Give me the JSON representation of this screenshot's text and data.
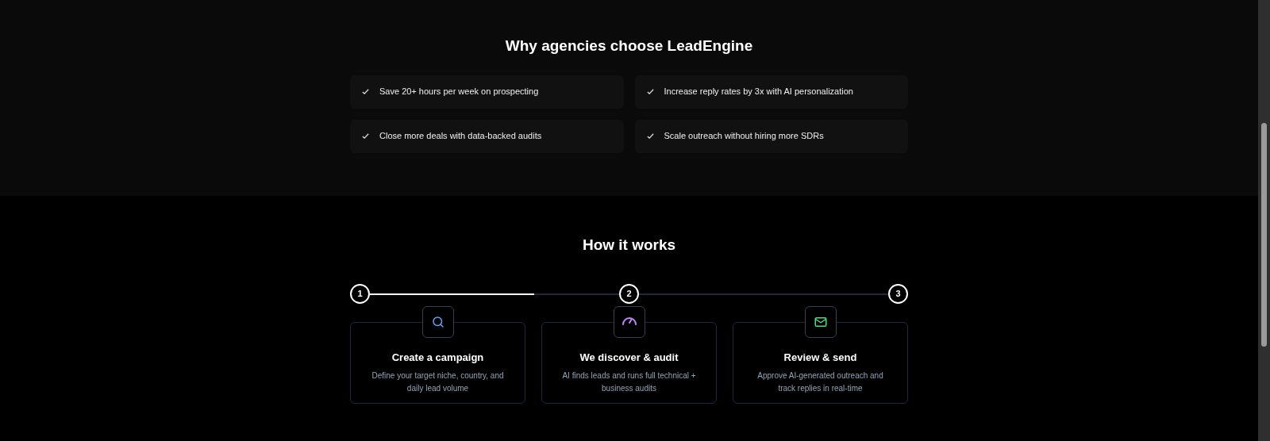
{
  "benefits": {
    "title": "Why agencies choose LeadEngine",
    "items": [
      "Save 20+ hours per week on prospecting",
      "Increase reply rates by 3x with AI personalization",
      "Close more deals with data-backed audits",
      "Scale outreach without hiring more SDRs"
    ]
  },
  "how_it_works": {
    "title": "How it works",
    "steps": [
      {
        "number": "1",
        "kind": "search",
        "title": "Create a campaign",
        "description": "Define your target niche, country, and daily lead volume"
      },
      {
        "number": "2",
        "kind": "gauge",
        "title": "We discover & audit",
        "description": "AI finds leads and runs full technical + business audits"
      },
      {
        "number": "3",
        "kind": "mail",
        "title": "Review & send",
        "description": "Approve AI-generated outreach and track replies in real-time"
      }
    ]
  }
}
